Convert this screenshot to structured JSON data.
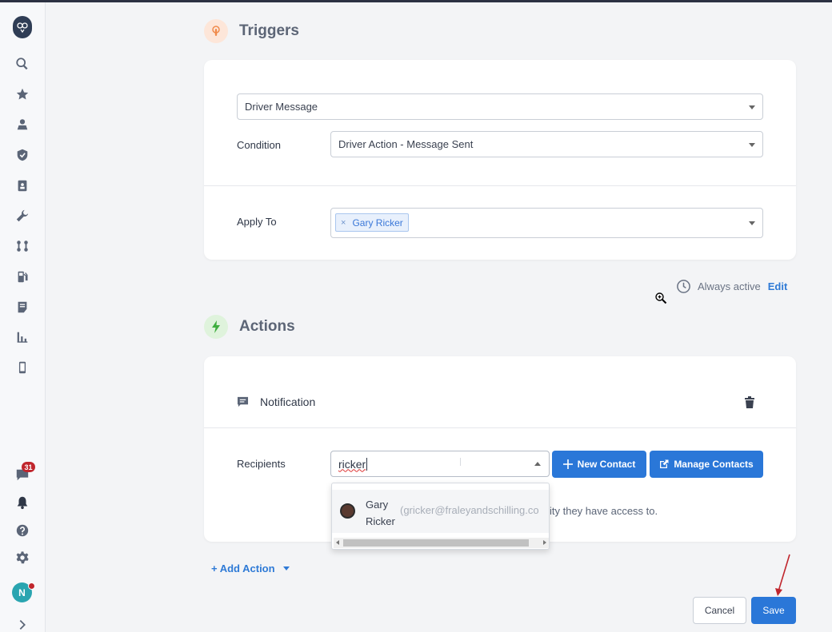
{
  "sidebar": {
    "items": [
      {
        "icon": "search-icon"
      },
      {
        "icon": "star-icon"
      },
      {
        "icon": "map-pin-user-icon"
      },
      {
        "icon": "shield-check-icon"
      },
      {
        "icon": "clipboard-user-icon"
      },
      {
        "icon": "wrench-icon"
      },
      {
        "icon": "route-icon"
      },
      {
        "icon": "fuel-pump-icon"
      },
      {
        "icon": "document-icon"
      },
      {
        "icon": "bar-chart-icon"
      },
      {
        "icon": "mobile-device-icon"
      }
    ],
    "bottom": {
      "messages_badge": "31",
      "avatar_initial": "N"
    }
  },
  "triggers": {
    "title": "Triggers",
    "trigger_select_value": "Driver Message",
    "condition_label": "Condition",
    "condition_value": "Driver Action - Message Sent",
    "apply_to_label": "Apply To",
    "apply_to_tags": [
      "Gary Ricker"
    ],
    "tag_remove": "×"
  },
  "schedule": {
    "status": "Always active",
    "edit_label": "Edit"
  },
  "actions": {
    "title": "Actions",
    "notification_label": "Notification",
    "recipients_label": "Recipients",
    "recipients_input_value": "ricker",
    "new_contact_label": "New Contact",
    "manage_contacts_label": "Manage Contacts",
    "hint_text_visible": "ity they have access to.",
    "dropdown_options": [
      {
        "name": "Gary Ricker",
        "email": "(gricker@fraleyandschilling.co"
      }
    ]
  },
  "footer": {
    "add_action_label": "+ Add Action",
    "cancel_label": "Cancel",
    "save_label": "Save"
  },
  "colors": {
    "accent": "#2a77d8",
    "trigger_icon": "#f08a4b",
    "action_icon": "#3fae3f",
    "badge": "#c0262d"
  }
}
